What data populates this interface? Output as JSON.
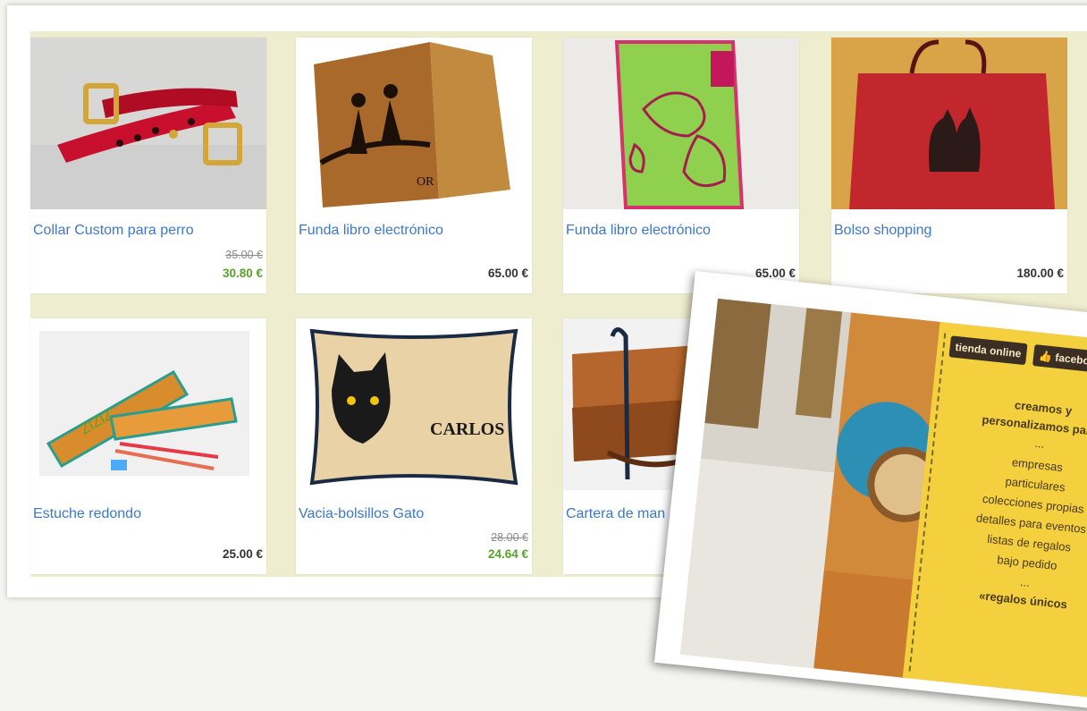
{
  "products": [
    {
      "title": "Collar Custom para perro",
      "old_price": "35.00 €",
      "price": "30.80 €",
      "image_icon": "dog-collar-photo"
    },
    {
      "title": "Funda libro electrónico",
      "old_price": "",
      "price": "65.00 €",
      "image_icon": "ebook-cover-hikers-photo"
    },
    {
      "title": "Funda libro electrónico",
      "old_price": "",
      "price": "65.00 €",
      "image_icon": "ebook-cover-paisley-photo"
    },
    {
      "title": "Bolso shopping",
      "old_price": "",
      "price": "180.00 €",
      "image_icon": "cat-tote-bag-photo"
    },
    {
      "title": "Estuche redondo",
      "old_price": "",
      "price": "25.00 €",
      "image_icon": "pencil-case-photo"
    },
    {
      "title": "Vacia-bolsillos Gato",
      "old_price": "28.00 €",
      "price": "24.64 €",
      "image_icon": "cat-tray-photo"
    },
    {
      "title": "Cartera de man",
      "old_price": "",
      "price": "",
      "image_icon": "handbag-photo"
    }
  ],
  "tray_text": "CARLOS",
  "cover_initials": "OR",
  "overlay": {
    "buttons": [
      "tienda online",
      "facebook"
    ],
    "lines": [
      "creamos y",
      "personalizamos para:",
      "...",
      "empresas",
      "particulares",
      "colecciones propias",
      "detalles para eventos",
      "listas de regalos",
      "bajo pedido",
      "...",
      "«regalos únicos"
    ]
  },
  "colors": {
    "link": "#3d78c7",
    "sale": "#5aa12b",
    "band": "#efedcf",
    "poster": "#f4d03f"
  }
}
